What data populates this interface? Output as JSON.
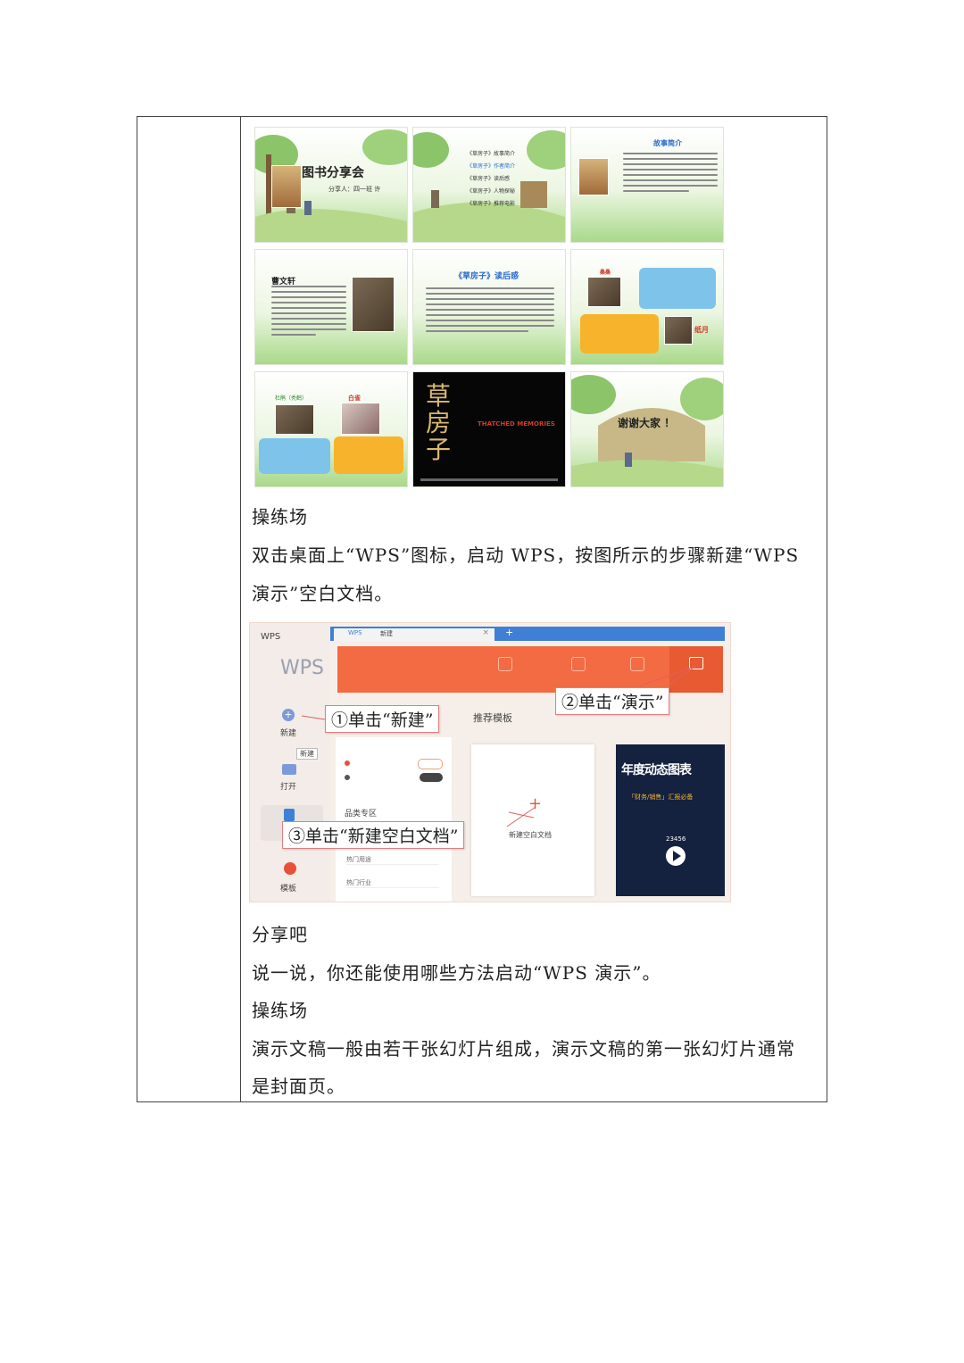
{
  "slides": {
    "s1_title": "图书分享会",
    "s1_sub": "分享人：四一班 许",
    "s1_book": "草房子",
    "s2_items": [
      "《草房子》故事简介",
      "《草房子》作者简介",
      "《草房子》读后感",
      "《草房子》人物探秘",
      "《草房子》推荐电影"
    ],
    "s3_title": "故事简介",
    "s4_title": "曹文轩",
    "s5_title": "《草房子》读后感",
    "s6_name1": "桑桑",
    "s6_name2": "纸月",
    "s7_name1": "杜鹃（秃鹤）",
    "s7_name2": "白雀",
    "s8_title": "草房子",
    "s8_sub": "THATCHED MEMORIES",
    "s9_title": "谢谢大家 ！"
  },
  "text": {
    "heading1": "操练场",
    "para1_line1": "双击桌面上“WPS”图标，启动 WPS，按图所示的步骤新建“WPS",
    "para1_line2": "演示”空白文档。",
    "heading2": "分享吧",
    "para2": "说一说，你还能使用哪些方法启动“WPS 演示”。",
    "heading3": "操练场",
    "para3_line1": "演示文稿一般由若干张幻灯片组成，演示文稿的第一张幻灯片通常",
    "para3_line2": "是封面页。"
  },
  "wps": {
    "app_name": "WPS",
    "logo": "WPS",
    "tab_label": "新建",
    "side_new": "新建",
    "side_new_tip": "新建",
    "side_open": "打开",
    "side_template": "模板",
    "recommend": "推荐模板",
    "category_zone": "品类专区",
    "hot_use": "热门用途",
    "hot_industry": "热门行业",
    "new_blank": "新建空白文档",
    "banner_title": "年度动态图表",
    "banner_sub": "「财务/销售」汇报必备",
    "banner_num": "23456",
    "callout1": "①单击“新建”",
    "callout2": "②单击“演示”",
    "callout3": "③单击“新建空白文档”",
    "colors": {
      "orange": "#f26b43",
      "blue": "#3f7fd6",
      "dark_banner": "#14213f"
    }
  }
}
